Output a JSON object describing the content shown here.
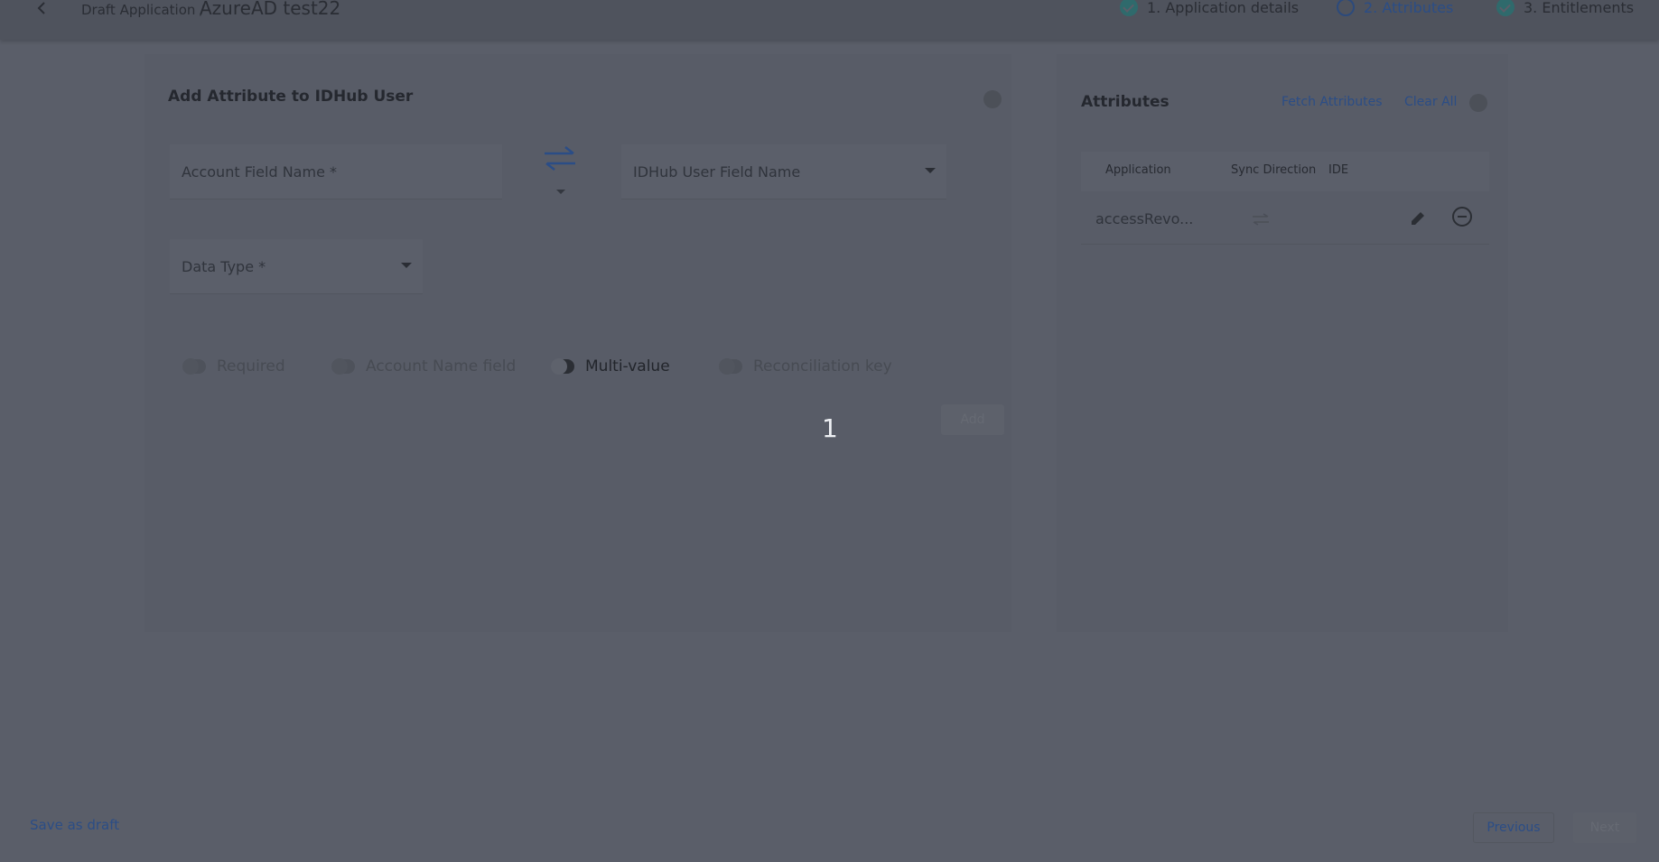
{
  "header": {
    "breadcrumb_prefix": "Draft Application /",
    "app_title": "AzureAD test22",
    "steps": [
      {
        "label": "1. Application details",
        "state": "done"
      },
      {
        "label": "2. Attributes",
        "state": "active"
      },
      {
        "label": "3. Entitlements",
        "state": "done"
      }
    ]
  },
  "form": {
    "title": "Add Attribute to IDHub User",
    "account_field_placeholder": "Account Field Name *",
    "idhub_field_placeholder": "IDHub User Field Name",
    "data_type_placeholder": "Data Type *",
    "toggles": [
      {
        "label": "Required",
        "on": false
      },
      {
        "label": "Account Name field",
        "on": false
      },
      {
        "label": "Multi-value",
        "on": true
      },
      {
        "label": "Reconciliation key",
        "on": false
      }
    ],
    "add_label": "Add",
    "step_number": "1"
  },
  "attributes": {
    "title": "Attributes",
    "fetch_label": "Fetch Attributes",
    "clear_label": "Clear All",
    "columns": [
      "Application",
      "Sync Direction",
      "IDE"
    ],
    "rows": [
      {
        "application": "accessRevo..."
      }
    ]
  },
  "footer": {
    "save_draft_label": "Save as draft",
    "previous_label": "Previous",
    "next_label": "Next"
  },
  "colors": {
    "accent": "#2b4d86",
    "overlay_bg": "#5a5e69"
  }
}
